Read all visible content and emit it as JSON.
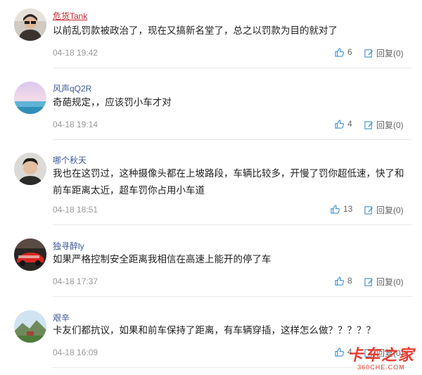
{
  "colors": {
    "highlight_name": "#c1272d",
    "name": "#3b5998",
    "accent": "#3b8fd6"
  },
  "comments": [
    {
      "user": "危货Tank",
      "content": "以前乱罚款被政治了，现在又搞新名堂了，总之以罚款为目的就对了",
      "time": "04-18 19:42",
      "likes": "6",
      "reply": "回复(0)"
    },
    {
      "user": "风声qQ2R",
      "content": "奇葩规定，，应该罚小车才对",
      "time": "04-18 19:14",
      "likes": "4",
      "reply": "回复(0)"
    },
    {
      "user": "哪个秋天",
      "content": "我也在这罚过，这种摄像头都在上坡路段，车辆比较多，开慢了罚你超低速，快了和前车距离太近，超车罚你占用小车道",
      "time": "04-18 18:51",
      "likes": "13",
      "reply": "回复(0)"
    },
    {
      "user": "独寻醉ly",
      "content": "如果严格控制安全距离我相信在高速上能开的停了车",
      "time": "04-18 17:37",
      "likes": "8",
      "reply": "回复(0)"
    },
    {
      "user": "艰辛",
      "content": "卡友们都抗议，如果和前车保持了距离，有车辆穿插，这样怎么做？？？？？",
      "time": "04-18 16:09",
      "likes": "4",
      "reply": "回复(0)"
    }
  ],
  "watermark": {
    "main": "卡车之家",
    "sub": "360CHE.COM"
  },
  "icons": {
    "like": "thumbs-up-icon",
    "reply": "reply-edit-icon"
  }
}
